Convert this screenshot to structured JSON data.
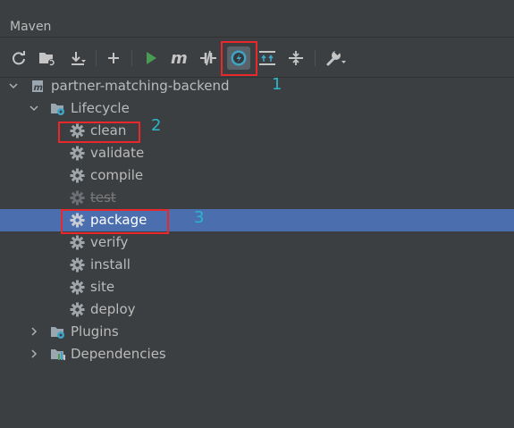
{
  "window": {
    "title": "Maven"
  },
  "toolbar": {
    "buttons": [
      {
        "name": "reload-icon"
      },
      {
        "name": "add-source-folder-icon"
      },
      {
        "name": "download-icon"
      },
      {
        "name": "add-icon"
      },
      {
        "name": "run-icon"
      },
      {
        "name": "execute-goal-icon"
      },
      {
        "name": "toggle-offline-icon"
      },
      {
        "name": "skip-tests-icon"
      },
      {
        "name": "show-dependencies-icon"
      },
      {
        "name": "collapse-all-icon"
      },
      {
        "name": "settings-wrench-icon"
      }
    ]
  },
  "tree": {
    "project": "partner-matching-backend",
    "lifecycle_label": "Lifecycle",
    "lifecycle": [
      "clean",
      "validate",
      "compile",
      "test",
      "package",
      "verify",
      "install",
      "site",
      "deploy"
    ],
    "plugins_label": "Plugins",
    "dependencies_label": "Dependencies"
  },
  "annotations": {
    "one": "1",
    "two": "2",
    "three": "3"
  },
  "colors": {
    "background": "#3c3f41",
    "selection": "#4b6eaf",
    "highlight_box": "#e8282b",
    "annotation_text": "#2ab7ca",
    "run_green": "#499c54"
  }
}
